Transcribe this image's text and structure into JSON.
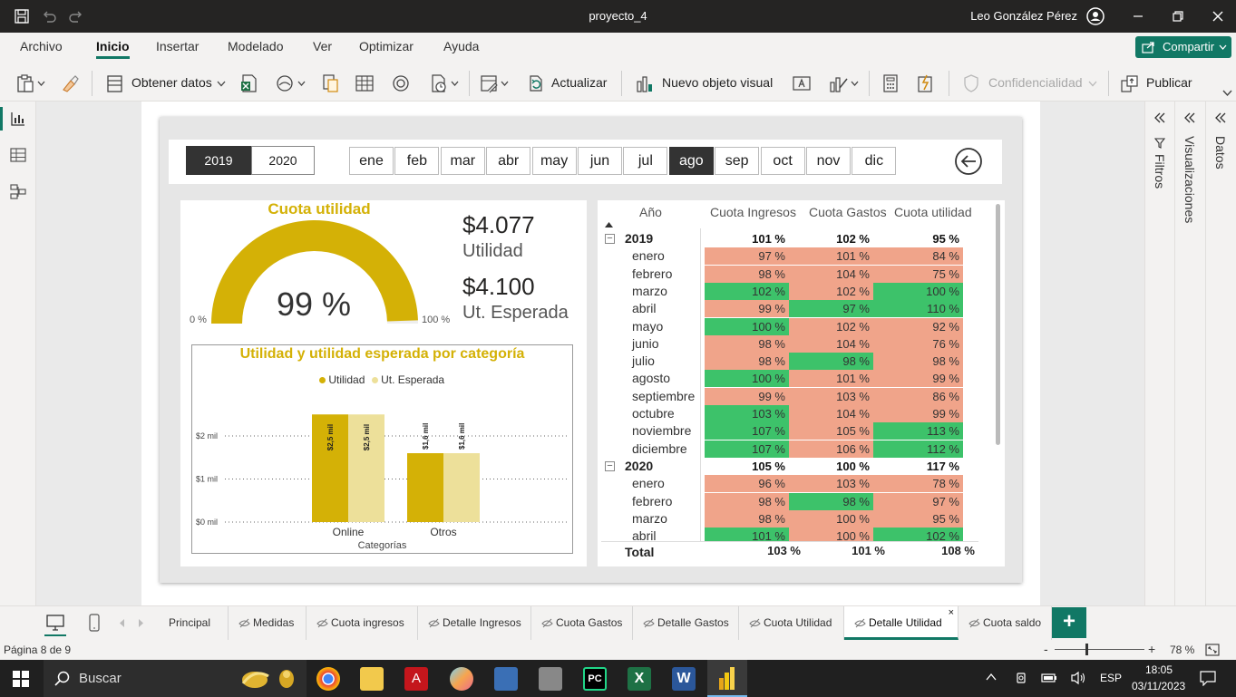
{
  "window": {
    "title": "proyecto_4",
    "user": "Leo González Pérez"
  },
  "menu": {
    "items": [
      "Archivo",
      "Inicio",
      "Insertar",
      "Modelado",
      "Ver",
      "Optimizar",
      "Ayuda"
    ],
    "active": "Inicio"
  },
  "share_label": "Compartir",
  "ribbon": {
    "get_data": "Obtener datos",
    "refresh": "Actualizar",
    "new_visual": "Nuevo objeto visual",
    "sensitivity": "Confidencialidad",
    "publish": "Publicar"
  },
  "slicers": {
    "years": [
      "2019",
      "2020"
    ],
    "selected_year": "2019",
    "months": [
      "ene",
      "feb",
      "mar",
      "abr",
      "may",
      "jun",
      "jul",
      "ago",
      "sep",
      "oct",
      "nov",
      "dic"
    ],
    "selected_month": "ago"
  },
  "gauge": {
    "title": "Cuota utilidad",
    "value_label": "99 %",
    "value_fraction": 0.99,
    "min_label": "0 %",
    "max_label": "100 %",
    "color": "#d4b106"
  },
  "kpis": [
    {
      "value": "$4.077",
      "label": "Utilidad"
    },
    {
      "value": "$4.100",
      "label": "Ut. Esperada"
    }
  ],
  "chart_data": {
    "type": "bar",
    "title": "Utilidad y utilidad esperada por categoría",
    "categories": [
      "Online",
      "Otros"
    ],
    "series": [
      {
        "name": "Utilidad",
        "values": [
          2.5,
          1.6
        ],
        "color": "#d4b106",
        "labels": [
          "$2,5 mil",
          "$1,6 mil"
        ]
      },
      {
        "name": "Ut. Esperada",
        "values": [
          2.5,
          1.6
        ],
        "color": "#ede09a",
        "labels": [
          "$2,5 mil",
          "$1,6 mil"
        ]
      }
    ],
    "ytick_labels": [
      "$0 mil",
      "$1 mil",
      "$2 mil"
    ],
    "yticks": [
      0,
      1,
      2
    ],
    "ylim": [
      0,
      2.5
    ],
    "xlabel": "Categorías",
    "legend": "top-center",
    "grid": true
  },
  "matrix": {
    "headers": [
      "Año",
      "Cuota Ingresos",
      "Cuota Gastos",
      "Cuota utilidad"
    ],
    "colors": {
      "red": "#f0a48a",
      "green": "#3dc26a"
    },
    "rows": [
      {
        "name": "2019",
        "type": "year",
        "vals": [
          "101 %",
          "102 %",
          "95 %"
        ],
        "c": [
          "",
          "",
          ""
        ]
      },
      {
        "name": "enero",
        "vals": [
          "97 %",
          "101 %",
          "84 %"
        ],
        "c": [
          "r",
          "r",
          "r"
        ]
      },
      {
        "name": "febrero",
        "vals": [
          "98 %",
          "104 %",
          "75 %"
        ],
        "c": [
          "r",
          "r",
          "r"
        ]
      },
      {
        "name": "marzo",
        "vals": [
          "102 %",
          "102 %",
          "100 %"
        ],
        "c": [
          "g",
          "r",
          "g"
        ]
      },
      {
        "name": "abril",
        "vals": [
          "99 %",
          "97 %",
          "110 %"
        ],
        "c": [
          "r",
          "g",
          "g"
        ]
      },
      {
        "name": "mayo",
        "vals": [
          "100 %",
          "102 %",
          "92 %"
        ],
        "c": [
          "g",
          "r",
          "r"
        ]
      },
      {
        "name": "junio",
        "vals": [
          "98 %",
          "104 %",
          "76 %"
        ],
        "c": [
          "r",
          "r",
          "r"
        ]
      },
      {
        "name": "julio",
        "vals": [
          "98 %",
          "98 %",
          "98 %"
        ],
        "c": [
          "r",
          "g",
          "r"
        ]
      },
      {
        "name": "agosto",
        "vals": [
          "100 %",
          "101 %",
          "99 %"
        ],
        "c": [
          "g",
          "r",
          "r"
        ]
      },
      {
        "name": "septiembre",
        "vals": [
          "99 %",
          "103 %",
          "86 %"
        ],
        "c": [
          "r",
          "r",
          "r"
        ]
      },
      {
        "name": "octubre",
        "vals": [
          "103 %",
          "104 %",
          "99 %"
        ],
        "c": [
          "g",
          "r",
          "r"
        ]
      },
      {
        "name": "noviembre",
        "vals": [
          "107 %",
          "105 %",
          "113 %"
        ],
        "c": [
          "g",
          "r",
          "g"
        ]
      },
      {
        "name": "diciembre",
        "vals": [
          "107 %",
          "106 %",
          "112 %"
        ],
        "c": [
          "g",
          "r",
          "g"
        ]
      },
      {
        "name": "2020",
        "type": "year",
        "vals": [
          "105 %",
          "100 %",
          "117 %"
        ],
        "c": [
          "",
          "",
          ""
        ]
      },
      {
        "name": "enero",
        "vals": [
          "96 %",
          "103 %",
          "78 %"
        ],
        "c": [
          "r",
          "r",
          "r"
        ]
      },
      {
        "name": "febrero",
        "vals": [
          "98 %",
          "98 %",
          "97 %"
        ],
        "c": [
          "r",
          "g",
          "r"
        ]
      },
      {
        "name": "marzo",
        "vals": [
          "98 %",
          "100 %",
          "95 %"
        ],
        "c": [
          "r",
          "r",
          "r"
        ]
      },
      {
        "name": "abril",
        "vals": [
          "101 %",
          "100 %",
          "102 %"
        ],
        "c": [
          "g",
          "r",
          "g"
        ]
      }
    ],
    "total": {
      "name": "Total",
      "vals": [
        "103 %",
        "101 %",
        "108 %"
      ]
    }
  },
  "panes": {
    "filters": "Filtros",
    "visualizations": "Visualizaciones",
    "data": "Datos"
  },
  "page_tabs": [
    "Principal",
    "Medidas",
    "Cuota ingresos",
    "Detalle Ingresos",
    "Cuota Gastos",
    "Detalle Gastos",
    "Cuota Utilidad",
    "Detalle Utilidad",
    "Cuota saldo"
  ],
  "active_tab": "Detalle Utilidad",
  "status": {
    "page": "Página 8 de 9",
    "zoom": "78 %"
  },
  "taskbar": {
    "search": "Buscar",
    "lang": "ESP",
    "time": "18:05",
    "date": "03/11/2023"
  }
}
